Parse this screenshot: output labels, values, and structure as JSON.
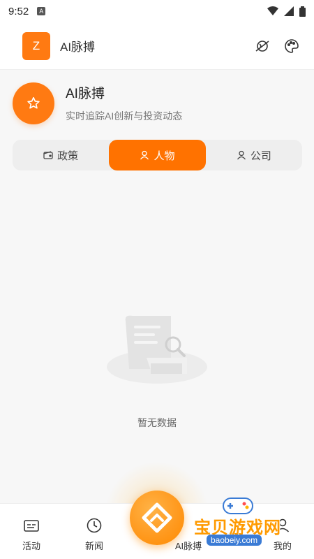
{
  "status": {
    "time": "9:52",
    "a_label": "A"
  },
  "app": {
    "logo_letter": "Z",
    "title": "AI脉搏"
  },
  "header": {
    "title": "AI脉搏",
    "subtitle": "实时追踪AI创新与投资动态"
  },
  "tabs": [
    {
      "label": "政策",
      "icon": "wallet-icon",
      "active": false
    },
    {
      "label": "人物",
      "icon": "person-icon",
      "active": true
    },
    {
      "label": "公司",
      "icon": "person-icon",
      "active": false
    }
  ],
  "empty": {
    "text": "暂无数据"
  },
  "bottom_nav": {
    "items": [
      {
        "label": "活动",
        "icon": "activity-icon"
      },
      {
        "label": "新闻",
        "icon": "clock-icon"
      },
      {
        "label": "AI脉搏",
        "icon": "pulse-icon"
      },
      {
        "label": "我的",
        "icon": "user-icon"
      }
    ]
  },
  "watermark": {
    "text": "宝贝游戏网",
    "url": "baobeiy.com"
  },
  "colors": {
    "accent": "#ff7200",
    "page_bg": "#f7f7f7",
    "tab_bg": "#eeeeee"
  }
}
